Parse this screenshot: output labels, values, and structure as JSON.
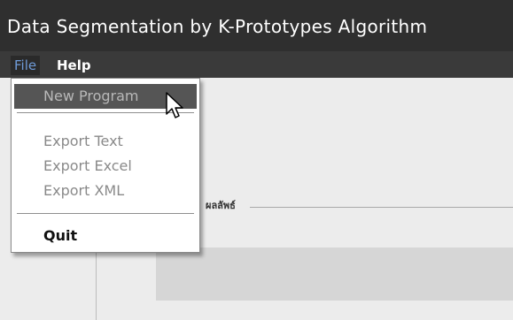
{
  "window": {
    "title": "Data Segmentation by K-Prototypes Algorithm"
  },
  "menubar": {
    "file_label": "File",
    "help_label": "Help"
  },
  "file_menu": {
    "new_program": "New Program",
    "export_text": "Export Text",
    "export_excel": "Export Excel",
    "export_xml": "Export XML",
    "quit": "Quit"
  },
  "content": {
    "group_label": "ผลลัพธ์"
  },
  "colors": {
    "titlebar": "#2f2f2f",
    "menubar": "#3a3a3a",
    "highlight": "#555555"
  },
  "icons": {
    "pointer": "arrow-cursor-icon"
  }
}
